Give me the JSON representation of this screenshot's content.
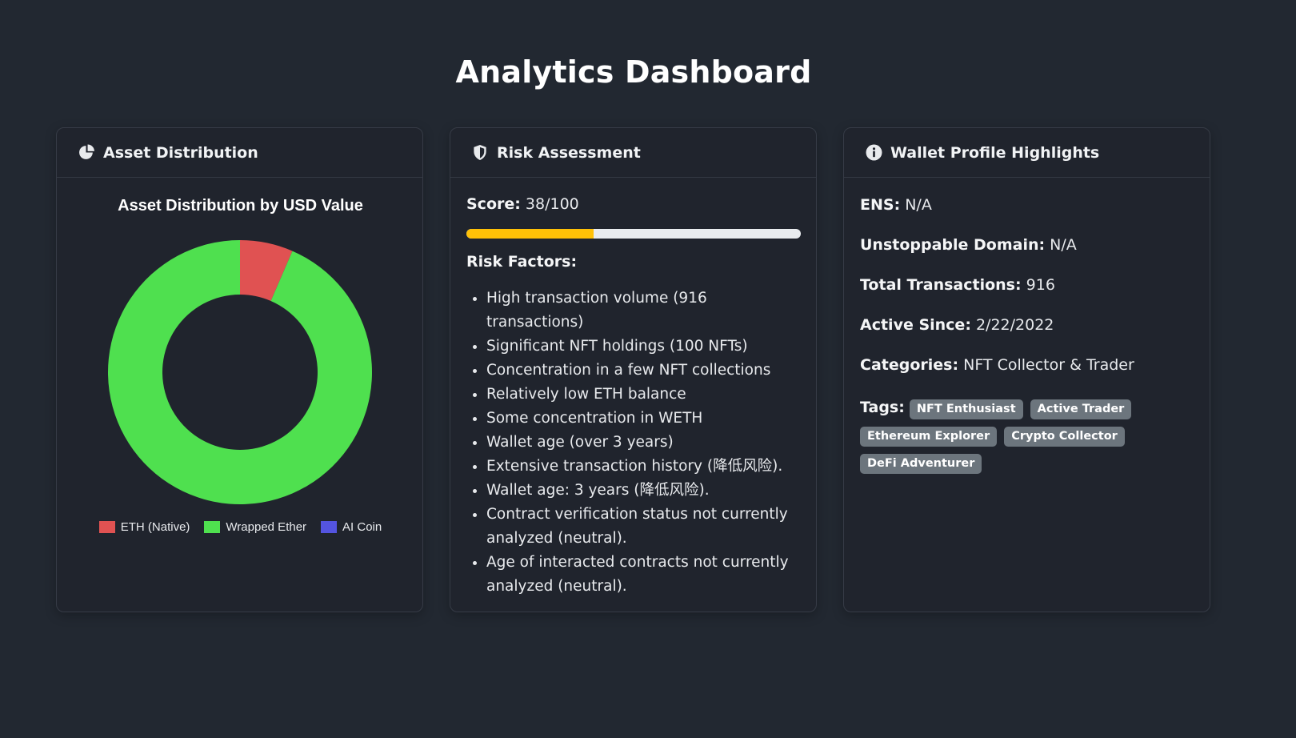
{
  "page": {
    "title": "Analytics Dashboard"
  },
  "asset_card": {
    "header": "Asset Distribution",
    "icon": "pie-chart-icon"
  },
  "risk_card": {
    "header": "Risk Assessment",
    "icon": "shield-icon",
    "score_label": "Score:",
    "score_value": "38/100",
    "score_fraction": 0.38,
    "bar_color": "#ffc107",
    "factors_label": "Risk Factors:",
    "factors": [
      "High transaction volume (916 transactions)",
      "Significant NFT holdings (100 NFTs)",
      "Concentration in a few NFT collections",
      "Relatively low ETH balance",
      "Some concentration in WETH",
      "Wallet age (over 3 years)",
      "Extensive transaction history (降低风险).",
      "Wallet age: 3 years (降低风险).",
      "Contract verification status not currently analyzed (neutral).",
      "Age of interacted contracts not currently analyzed (neutral)."
    ]
  },
  "profile_card": {
    "header": "Wallet Profile Highlights",
    "icon": "info-circle-icon",
    "ens_label": "ENS:",
    "ens_value": "N/A",
    "ud_label": "Unstoppable Domain:",
    "ud_value": "N/A",
    "tx_label": "Total Transactions:",
    "tx_value": "916",
    "since_label": "Active Since:",
    "since_value": "2/22/2022",
    "cat_label": "Categories:",
    "cat_value": "NFT Collector & Trader",
    "tags_label": "Tags:",
    "tags": [
      "NFT Enthusiast",
      "Active Trader",
      "Ethereum Explorer",
      "Crypto Collector",
      "DeFi Adventurer"
    ]
  },
  "chart_data": {
    "type": "pie",
    "variant": "doughnut",
    "title": "Asset Distribution by USD Value",
    "categories": [
      "ETH (Native)",
      "Wrapped Ether",
      "AI Coin"
    ],
    "values": [
      6.5,
      93.5,
      0
    ],
    "colors": [
      "#e05252",
      "#4fe04f",
      "#5454e0"
    ],
    "legend_position": "bottom"
  }
}
